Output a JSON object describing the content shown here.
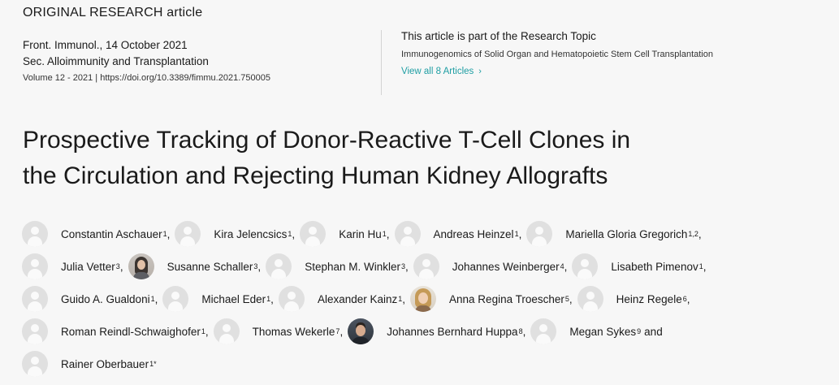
{
  "article_type": "ORIGINAL RESEARCH article",
  "meta": {
    "journal_date": "Front. Immunol., 14 October 2021",
    "section": "Sec. Alloimmunity and Transplantation",
    "volume_doi": "Volume 12 - 2021 | https://doi.org/10.3389/fimmu.2021.750005"
  },
  "research_topic": {
    "heading": "This article is part of the Research Topic",
    "name": "Immunogenomics of Solid Organ and Hematopoietic Stem Cell Transplantation",
    "view_all": "View all 8 Articles",
    "link_color": "#1e9ea3"
  },
  "title": {
    "line1": "Prospective Tracking of Donor-Reactive T-Cell Clones in",
    "line2": "the Circulation and Rejecting Human Kidney Allografts"
  },
  "authors": [
    {
      "name": "Constantin Aschauer",
      "aff": "1",
      "sep": ",",
      "avatar": "placeholder"
    },
    {
      "name": "Kira Jelencsics",
      "aff": "1",
      "sep": ",",
      "avatar": "placeholder"
    },
    {
      "name": "Karin Hu",
      "aff": "1",
      "sep": ",",
      "avatar": "placeholder"
    },
    {
      "name": "Andreas Heinzel",
      "aff": "1",
      "sep": ",",
      "avatar": "placeholder"
    },
    {
      "name": "Mariella Gloria Gregorich",
      "aff": "1,2",
      "sep": ",",
      "avatar": "placeholder"
    },
    {
      "name": "Julia Vetter",
      "aff": "3",
      "sep": ",",
      "avatar": "placeholder"
    },
    {
      "name": "Susanne Schaller",
      "aff": "3",
      "sep": ",",
      "avatar": "photo"
    },
    {
      "name": "Stephan M. Winkler",
      "aff": "3",
      "sep": ",",
      "avatar": "placeholder"
    },
    {
      "name": "Johannes Weinberger",
      "aff": "4",
      "sep": ",",
      "avatar": "placeholder"
    },
    {
      "name": "Lisabeth Pimenov",
      "aff": "1",
      "sep": ",",
      "avatar": "placeholder"
    },
    {
      "name": "Guido A. Gualdoni",
      "aff": "1",
      "sep": ",",
      "avatar": "placeholder"
    },
    {
      "name": "Michael Eder",
      "aff": "1",
      "sep": ",",
      "avatar": "placeholder"
    },
    {
      "name": "Alexander Kainz",
      "aff": "1",
      "sep": ",",
      "avatar": "placeholder"
    },
    {
      "name": "Anna Regina Troescher",
      "aff": "5",
      "sep": ",",
      "avatar": "photo"
    },
    {
      "name": "Heinz Regele",
      "aff": "6",
      "sep": ",",
      "avatar": "placeholder"
    },
    {
      "name": "Roman Reindl-Schwaighofer",
      "aff": "1",
      "sep": ",",
      "avatar": "placeholder"
    },
    {
      "name": "Thomas Wekerle",
      "aff": "7",
      "sep": ",",
      "avatar": "placeholder"
    },
    {
      "name": "Johannes Bernhard Huppa",
      "aff": "8",
      "sep": ",",
      "avatar": "photo"
    },
    {
      "name": "Megan Sykes",
      "aff": "9",
      "sep": "and",
      "avatar": "placeholder"
    },
    {
      "name": "Rainer Oberbauer",
      "aff": "1*",
      "sep": "",
      "avatar": "placeholder"
    }
  ]
}
